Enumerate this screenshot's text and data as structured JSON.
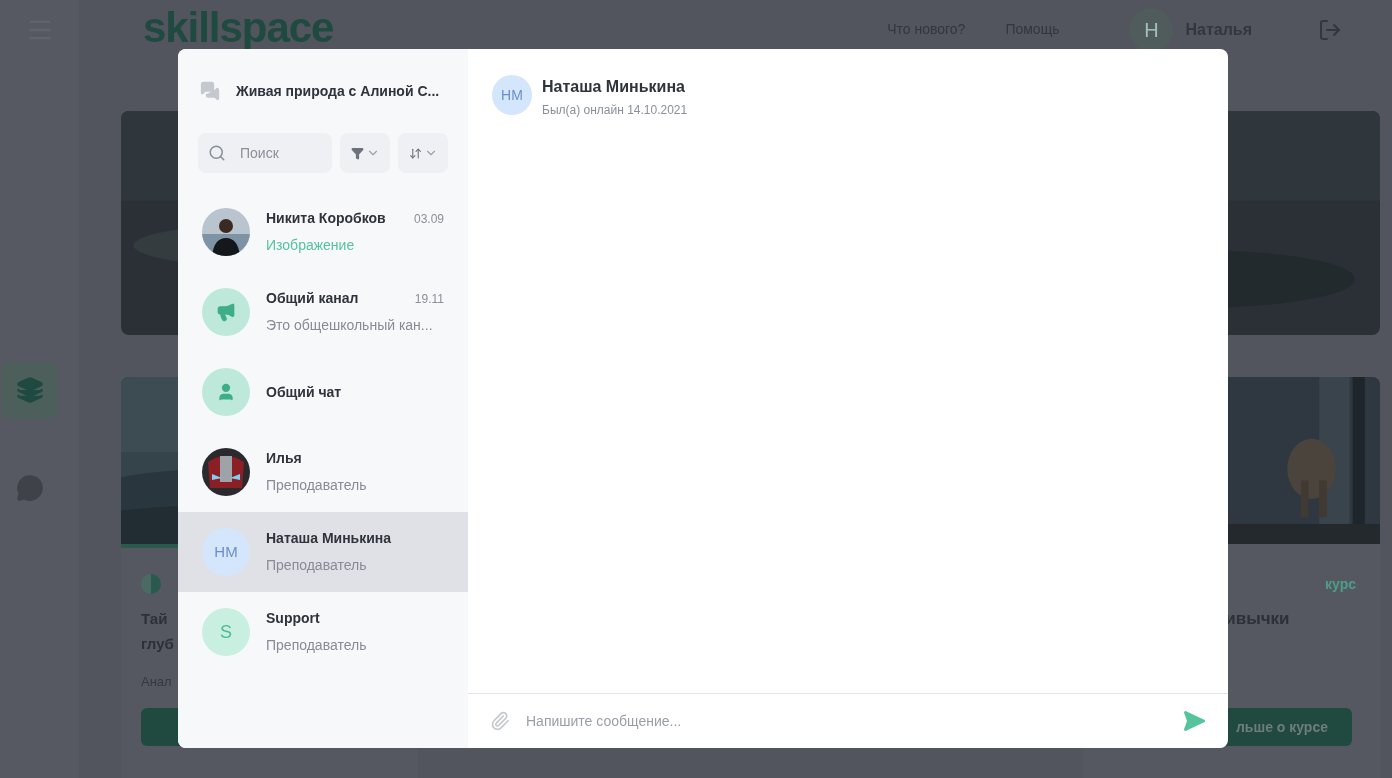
{
  "header": {
    "logo": "skillspace",
    "links": [
      "Что нового?",
      "Помощь"
    ],
    "user": {
      "initial": "Н",
      "name": "Наталья"
    }
  },
  "cards_behind": [
    {
      "title_lines": [
        "Тай",
        "глуб"
      ],
      "author": "Анал",
      "accent_stripe": true
    },
    {
      "tag": "курс",
      "title_lines": [
        "ивычки"
      ],
      "button": "льше о курсе"
    }
  ],
  "chat": {
    "title": "Живая природа с Алиной С...",
    "search": {
      "placeholder": "Поиск"
    },
    "chats": [
      {
        "name": "Никита Коробков",
        "time": "03.09",
        "preview": {
          "text": "Изображение",
          "color": "#55c39c"
        },
        "selected": false
      },
      {
        "name": "Общий канал",
        "time": "19.11",
        "preview": {
          "text": "Это общешкольный кан...",
          "color": "#868b95"
        },
        "avatar": {
          "kind": "channel"
        },
        "selected": false
      },
      {
        "name": "Общий чат",
        "avatar": {
          "kind": "group"
        },
        "selected": false
      },
      {
        "name": "Илья",
        "preview": {
          "text": "Преподаватель",
          "color": "#868b95"
        },
        "selected": false
      },
      {
        "name": "Наташа Минькина",
        "preview": {
          "text": "Преподаватель",
          "color": "#868b95"
        },
        "avatar": {
          "kind": "initials",
          "initials": "НМ",
          "color": "#d4e6fb"
        },
        "selected": true
      },
      {
        "name": "Support",
        "preview": {
          "text": "Преподаватель",
          "color": "#868b95"
        },
        "avatar": {
          "kind": "initials",
          "initials": "S",
          "color": "#c8efe0"
        },
        "selected": false
      }
    ],
    "conversation": {
      "initials": "НМ",
      "color": "#d4e6fb",
      "name": "Наташа Минькина",
      "status": "Был(а) онлайн 14.10.2021"
    },
    "composer": {
      "placeholder": "Напишите сообщение..."
    }
  }
}
